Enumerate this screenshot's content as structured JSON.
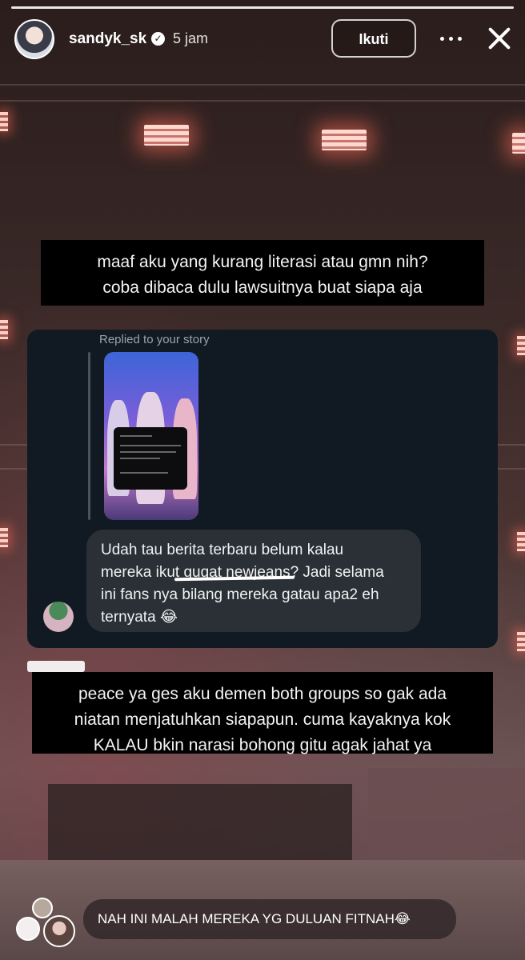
{
  "header": {
    "username": "sandyk_sk",
    "verified_icon": "verified-badge-icon",
    "time": "5 jam",
    "follow_label": "Ikuti",
    "more_icon": "more-options-icon",
    "close_icon": "close-icon"
  },
  "captions": {
    "caption_1_line_1": "maaf aku yang kurang literasi atau gmn nih?",
    "caption_1_line_2": "coba dibaca dulu lawsuitnya buat siapa aja",
    "caption_2_line_1": "peace ya ges aku demen both groups so gak ada",
    "caption_2_line_2": "niatan menjatuhkan siapapun. cuma kayaknya kok",
    "caption_2_line_3": "KALAU bkin narasi bohong gitu agak jahat ya"
  },
  "reply": {
    "label": "Replied to your story",
    "message_line_1": "Udah tau berita terbaru belum kalau",
    "message_line_2": "mereka ikut gugat newjeans? Jadi selama",
    "message_line_3": "ini fans nya bilang mereka gatau apa2 eh",
    "message_line_4": "ternyata 😂"
  },
  "bottom_comment": {
    "text": "NAH INI MALAH MEREKA YG DULUAN FITNAH😂"
  },
  "colors": {
    "caption_bg": "#000000",
    "reply_card_bg": "#111a22",
    "message_bubble_bg": "#2a3036"
  }
}
